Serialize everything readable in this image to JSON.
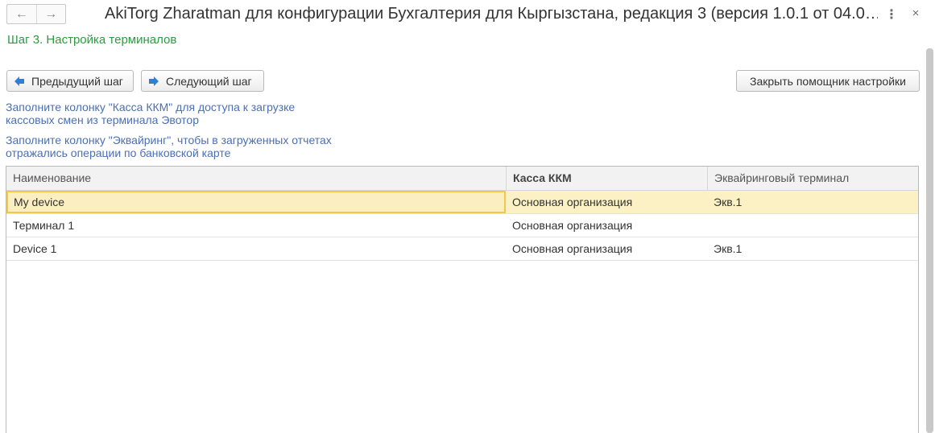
{
  "window": {
    "title": "AkiTorg Zharatman для конфигурации Бухгалтерия для Кыргызстана, редакция 3 (версия 1.0.1 от 04.0…",
    "back_glyph": "←",
    "forward_glyph": "→",
    "more_glyph": "⋮",
    "close_glyph": "×"
  },
  "step": {
    "title": "Шаг 3. Настройка терминалов"
  },
  "toolbar": {
    "prev_label": "Предыдущий шаг",
    "next_label": "Следующий шаг",
    "close_wizard_label": "Закрыть помощник настройки"
  },
  "hints": {
    "kkm_line1": "Заполните колонку \"Касса ККМ\" для доступа к загрузке",
    "kkm_line2": "кассовых смен из терминала Эвотор",
    "acq_line1": "Заполните колонку \"Эквайринг\", чтобы в загруженных отчетах",
    "acq_line2": "отражались операции по банковской карте"
  },
  "table": {
    "columns": [
      "Наименование",
      "Касса ККМ",
      "Эквайринговый терминал"
    ],
    "rows": [
      {
        "name": "My device",
        "kkm": "Основная организация",
        "acquiring": "Экв.1"
      },
      {
        "name": "Терминал 1",
        "kkm": "Основная организация",
        "acquiring": ""
      },
      {
        "name": "Device 1",
        "kkm": "Основная организация",
        "acquiring": "Экв.1"
      }
    ]
  },
  "colors": {
    "step_title": "#2a9d3e",
    "hint_text": "#4a6fb4",
    "arrow_blue": "#2f7fd4",
    "selected_row": "#fbf1c5",
    "selected_border": "#f2c84b"
  }
}
